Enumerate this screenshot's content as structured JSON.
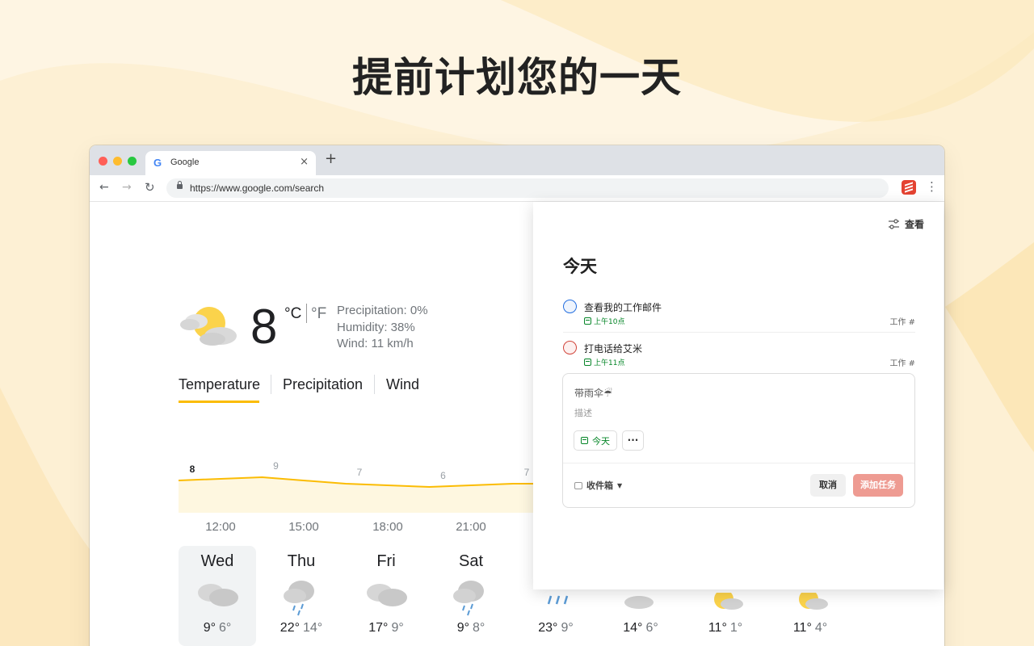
{
  "headline": "提前计划您的一天",
  "browser": {
    "tab_title": "Google",
    "tab_icon": "google-g-icon",
    "tab_close": "×",
    "new_tab": "+",
    "url": "https://www.google.com/search",
    "back": "←",
    "forward": "→",
    "reload": "↻",
    "menu": "⋮"
  },
  "weather": {
    "temperature": "8",
    "unit_c": "°C",
    "unit_f": "°F",
    "precipitation": "Precipitation: 0%",
    "humidity": "Humidity: 38%",
    "wind": "Wind: 11 km/h",
    "tabs": [
      "Temperature",
      "Precipitation",
      "Wind"
    ],
    "active_tab": "Temperature",
    "hours": [
      "12:00",
      "15:00",
      "18:00",
      "21:00"
    ],
    "days": [
      {
        "name": "Wed",
        "hi": "9°",
        "lo": "6°",
        "icon": "partly-cloudy-icon",
        "selected": true
      },
      {
        "name": "Thu",
        "hi": "22°",
        "lo": "14°",
        "icon": "rain-cloud-icon"
      },
      {
        "name": "Fri",
        "hi": "17°",
        "lo": "9°",
        "icon": "cloudy-icon"
      },
      {
        "name": "Sat",
        "hi": "9°",
        "lo": "8°",
        "icon": "rain-cloud-icon"
      },
      {
        "name": "",
        "hi": "23°",
        "lo": "9°",
        "icon": "rain-icon"
      },
      {
        "name": "",
        "hi": "14°",
        "lo": "6°",
        "icon": "cloudy-icon"
      },
      {
        "name": "",
        "hi": "11°",
        "lo": "1°",
        "icon": "partly-sunny-icon"
      },
      {
        "name": "",
        "hi": "11°",
        "lo": "4°",
        "icon": "partly-sunny-icon"
      }
    ]
  },
  "chart_data": {
    "type": "area",
    "x": [
      "12:00",
      "15:00",
      "18:00",
      "21:00",
      ""
    ],
    "values": [
      8,
      9,
      7,
      6,
      7
    ],
    "title": "",
    "xlabel": "",
    "ylabel": "",
    "color": "#fbbc04"
  },
  "todo": {
    "view_label": "查看",
    "title": "今天",
    "tasks": [
      {
        "name": "查看我的工作邮件",
        "due": "上午10点",
        "project": "工作 #",
        "color": "#246fe0"
      },
      {
        "name": "打电话给艾米",
        "due": "上午11点",
        "project": "工作 #",
        "color": "#d1453b"
      }
    ],
    "editor": {
      "name": "带雨伞☔",
      "description_placeholder": "描述",
      "due_chip": "今天",
      "more": "···",
      "project": "收件箱",
      "cancel": "取消",
      "add": "添加任务"
    }
  }
}
